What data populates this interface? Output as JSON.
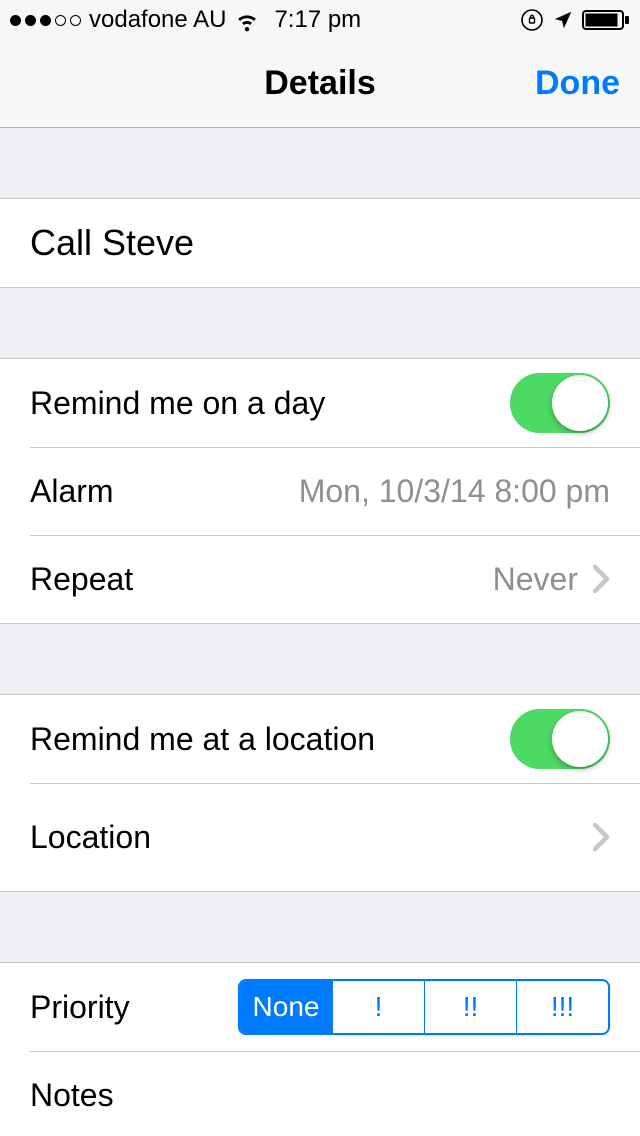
{
  "status": {
    "carrier": "vodafone AU",
    "time": "7:17 pm"
  },
  "nav": {
    "title": "Details",
    "done": "Done"
  },
  "reminder": {
    "title": "Call Steve"
  },
  "daySection": {
    "remindLabel": "Remind me on a day",
    "remindOn": true,
    "alarmLabel": "Alarm",
    "alarmValue": "Mon, 10/3/14 8:00 pm",
    "repeatLabel": "Repeat",
    "repeatValue": "Never"
  },
  "locationSection": {
    "remindLabel": "Remind me at a location",
    "remindOn": true,
    "locationLabel": "Location"
  },
  "prioritySection": {
    "label": "Priority",
    "options": [
      "None",
      "!",
      "!!",
      "!!!"
    ],
    "selectedIndex": 0,
    "notesLabel": "Notes"
  }
}
